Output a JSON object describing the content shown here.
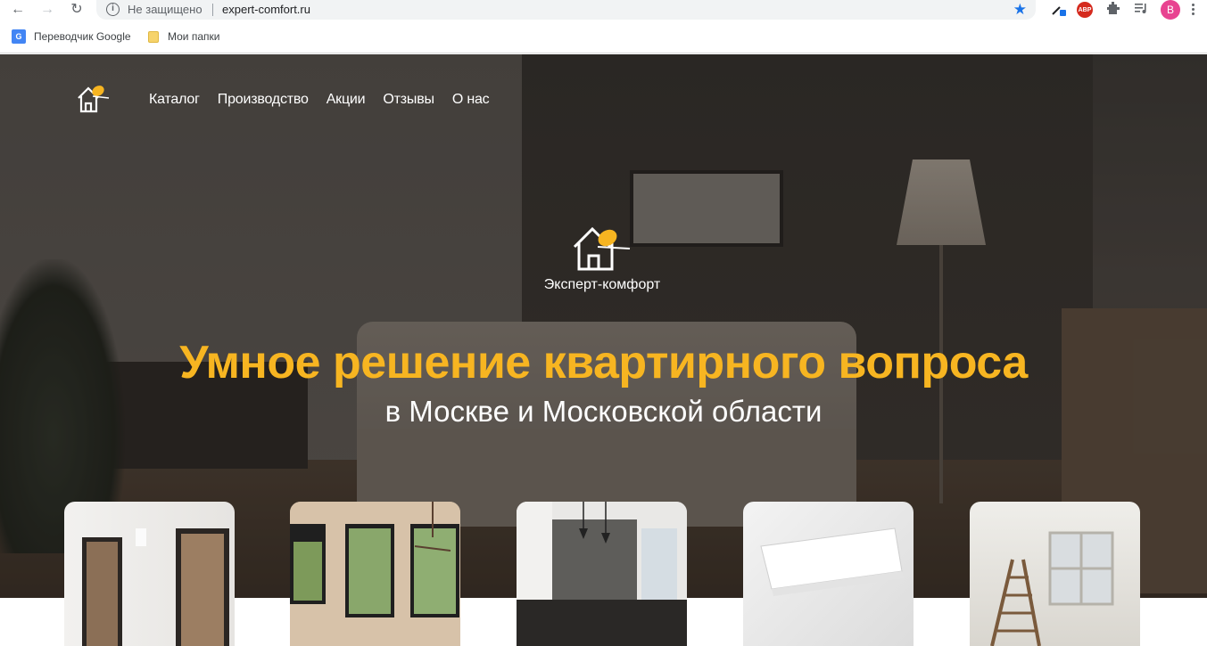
{
  "browser": {
    "security_label": "Не защищено",
    "url": "expert-comfort.ru",
    "info_symbol": "i",
    "abp_label": "ABP",
    "profile_initial": "B",
    "icons": [
      "back-icon",
      "forward-icon",
      "reload-icon",
      "info-icon",
      "star-icon",
      "eyedropper-icon",
      "adblock-icon",
      "extensions-icon",
      "media-icon",
      "avatar",
      "menu-icon"
    ]
  },
  "bookmarks": {
    "items": [
      {
        "label": "Переводчик Google",
        "icon": "google-translate-icon"
      },
      {
        "label": "Мои папки",
        "icon": "folder-icon"
      }
    ]
  },
  "site": {
    "nav": [
      "Каталог",
      "Производство",
      "Акции",
      "Отзывы",
      "О нас"
    ],
    "brand_name": "Эксперт-комфорт",
    "headline": "Умное решение квартирного вопроса",
    "subheadline": "в Москве и Московской области",
    "accent_color": "#f7b521",
    "category_cards": [
      "doors-photo",
      "windows-photo",
      "kitchen-photo",
      "air-conditioner-photo",
      "renovation-photo"
    ]
  }
}
